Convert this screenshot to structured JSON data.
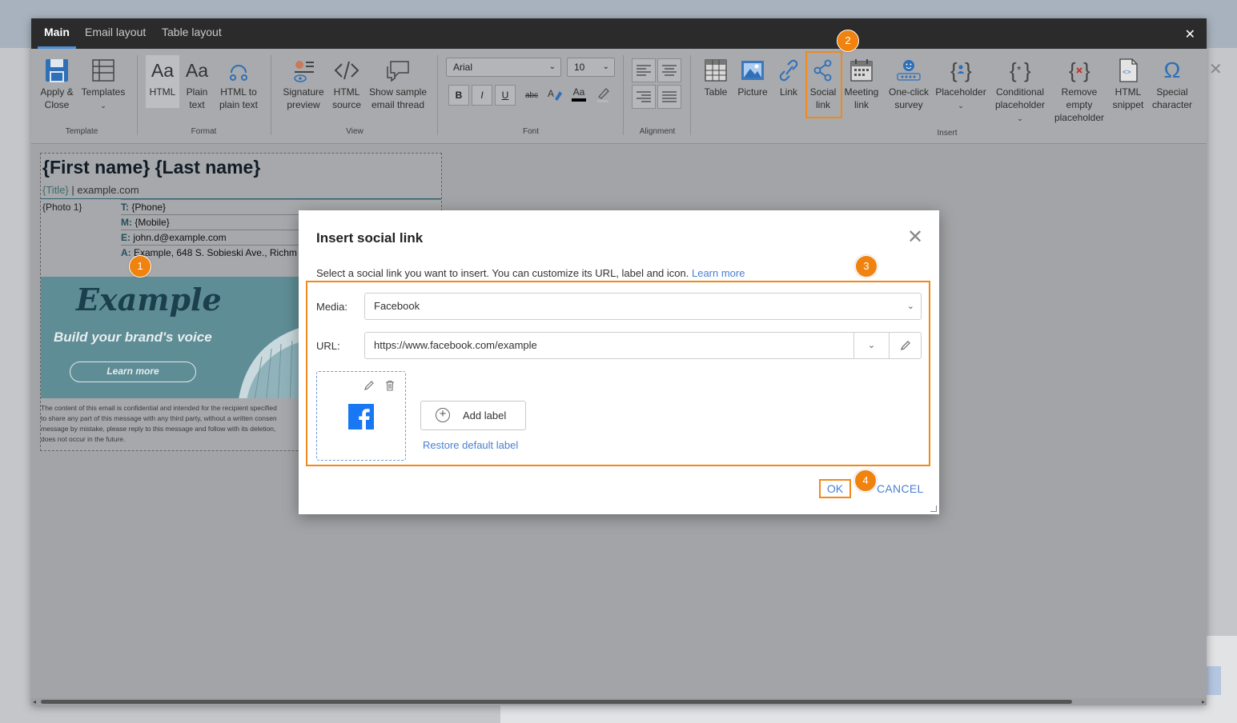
{
  "editor": {
    "tabs": [
      {
        "label": "Main",
        "active": true
      },
      {
        "label": "Email layout",
        "active": false
      },
      {
        "label": "Table layout",
        "active": false
      }
    ],
    "close_glyph": "✕"
  },
  "ribbon": {
    "groups": {
      "template": "Template",
      "format": "Format",
      "view": "View",
      "font": "Font",
      "alignment": "Alignment",
      "insert": "Insert"
    },
    "buttons": {
      "apply_close": [
        "Apply &",
        "Close"
      ],
      "templates": [
        "Templates",
        ""
      ],
      "html": [
        "HTML",
        ""
      ],
      "plain_text": [
        "Plain",
        "text"
      ],
      "html_to_plain": [
        "HTML to",
        "plain text"
      ],
      "signature_preview": [
        "Signature",
        "preview"
      ],
      "html_source": [
        "HTML",
        "source"
      ],
      "show_sample": [
        "Show sample",
        "email thread"
      ],
      "table": [
        "Table",
        ""
      ],
      "picture": [
        "Picture",
        ""
      ],
      "link": [
        "Link",
        ""
      ],
      "social_link": [
        "Social",
        "link"
      ],
      "meeting_link": [
        "Meeting",
        "link"
      ],
      "one_click_survey": [
        "One-click",
        "survey"
      ],
      "placeholder": [
        "Placeholder",
        ""
      ],
      "conditional_placeholder": [
        "Conditional",
        "placeholder"
      ],
      "remove_empty": [
        "Remove",
        "empty",
        "placeholder"
      ],
      "html_snippet": [
        "HTML",
        "snippet"
      ],
      "special_character": [
        "Special",
        "character"
      ]
    },
    "font_name": "Arial",
    "font_size": "10",
    "font_buttons": {
      "bold": "B",
      "italic": "I",
      "underline": "U",
      "strike": "abc",
      "color": "Aa"
    }
  },
  "signature": {
    "name": "{First name} {Last name}",
    "title_ph": "{Title}",
    "title_rest": " | example.com",
    "photo": "{Photo 1}",
    "rows": [
      {
        "k": "T:",
        "v": " {Phone}"
      },
      {
        "k": "M:",
        "v": " {Mobile}"
      },
      {
        "k": "E:",
        "v": " john.d@example.com"
      },
      {
        "k": "A:",
        "v": " Example, 648 S. Sobieski Ave., Richm"
      }
    ],
    "banner": {
      "logo": "Example",
      "tagline": "Build your brand's voice",
      "button": "Learn more"
    },
    "disclaimer": [
      "The content of this email is confidential and intended for the recipient specified",
      "to share any part of this message with any third party, without a written consen",
      "message by mistake, please reply to this message and follow with its deletion,",
      "does not occur in the future."
    ]
  },
  "dialog": {
    "title": "Insert social link",
    "close_glyph": "✕",
    "description": "Select a social link you want to insert. You can customize its URL, label and icon. ",
    "learn_more": "Learn more",
    "media_label": "Media:",
    "media_value": "Facebook",
    "url_label": "URL:",
    "url_value": "https://www.facebook.com/example",
    "add_label": "Add label",
    "restore_default": "Restore default label",
    "ok": "OK",
    "cancel": "CANCEL"
  },
  "annotations": [
    "1",
    "2",
    "3",
    "4"
  ],
  "colors": {
    "highlight": "#f08a1c",
    "badge": "#f0820f",
    "link": "#4a7fd0",
    "facebook": "#1877f2"
  }
}
